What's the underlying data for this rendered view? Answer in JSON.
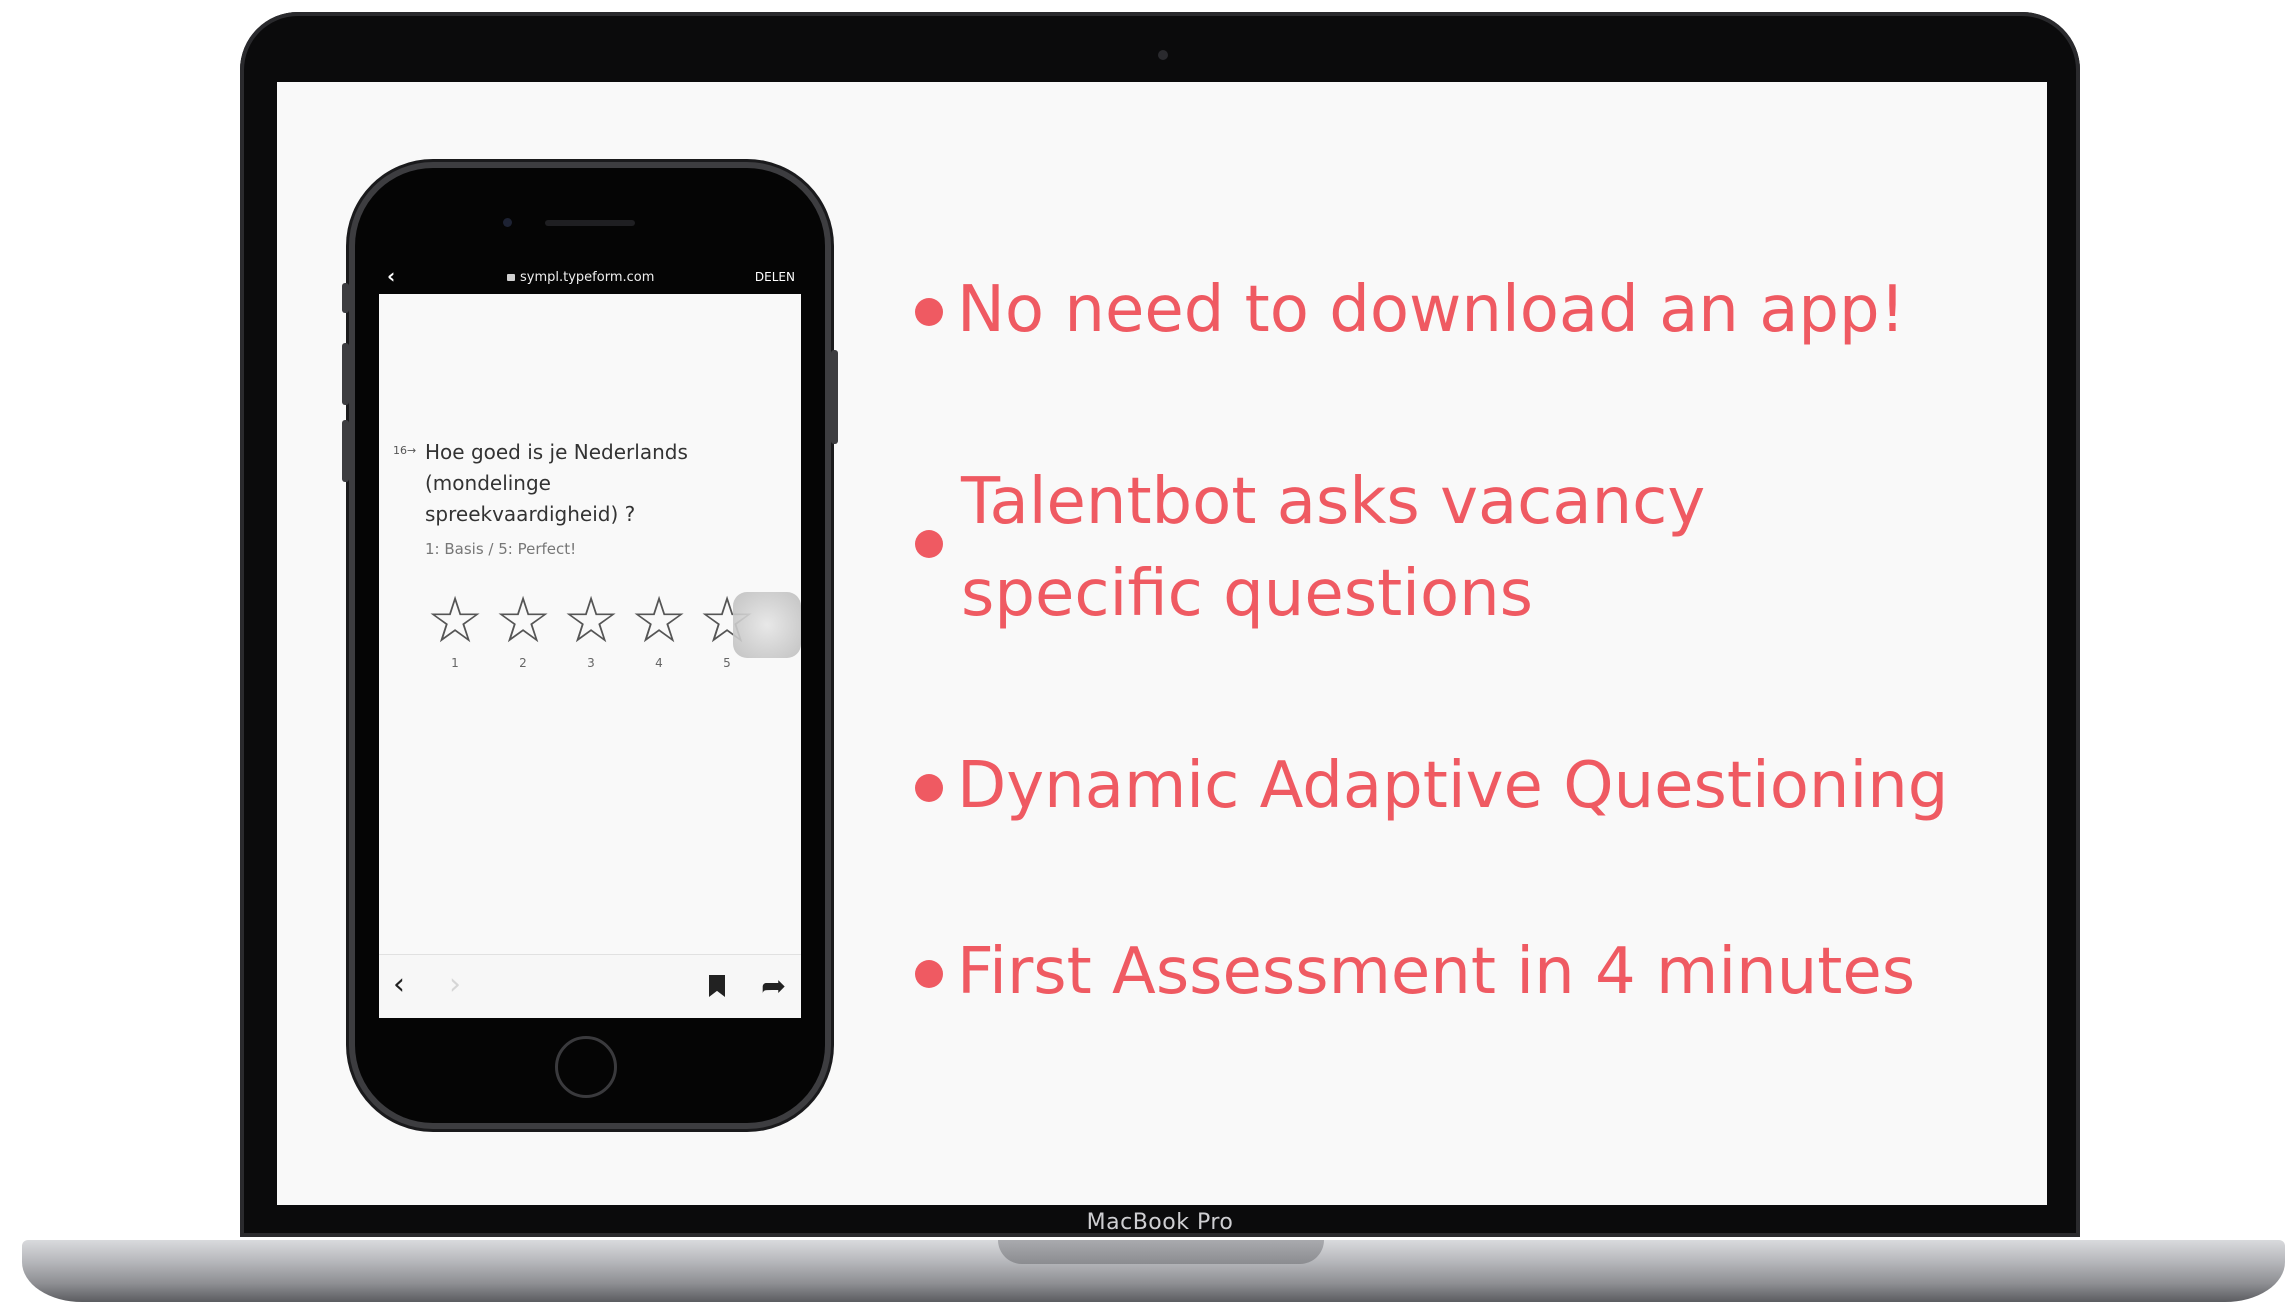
{
  "laptop": {
    "brand": "MacBook Pro"
  },
  "phone": {
    "browser": {
      "back_icon": "chevron-left-icon",
      "url": "sympl.typeform.com",
      "share_label": "DELEN"
    },
    "form": {
      "question_number": "16→",
      "question_lines": [
        "Hoe goed is je Nederlands",
        "(mondelinge",
        "spreekvaardigheid) ?"
      ],
      "hint": "1: Basis / 5: Perfect!",
      "stars": [
        "1",
        "2",
        "3",
        "4",
        "5"
      ],
      "star_glyph": "☆"
    },
    "toolbar": {
      "back_glyph": "‹",
      "forward_glyph": "›",
      "share_glyph": "➦"
    }
  },
  "features": [
    {
      "line1": "No need to download an app!",
      "line2": ""
    },
    {
      "line1": "Talentbot asks vacancy",
      "line2": "specific questions"
    },
    {
      "line1": "Dynamic Adaptive Questioning",
      "line2": ""
    },
    {
      "line1": "First Assessment in 4 minutes",
      "line2": ""
    }
  ],
  "colors": {
    "accent": "#ef5a62",
    "screen_bg": "#f9f9f9",
    "bezel": "#0b0b0c"
  }
}
